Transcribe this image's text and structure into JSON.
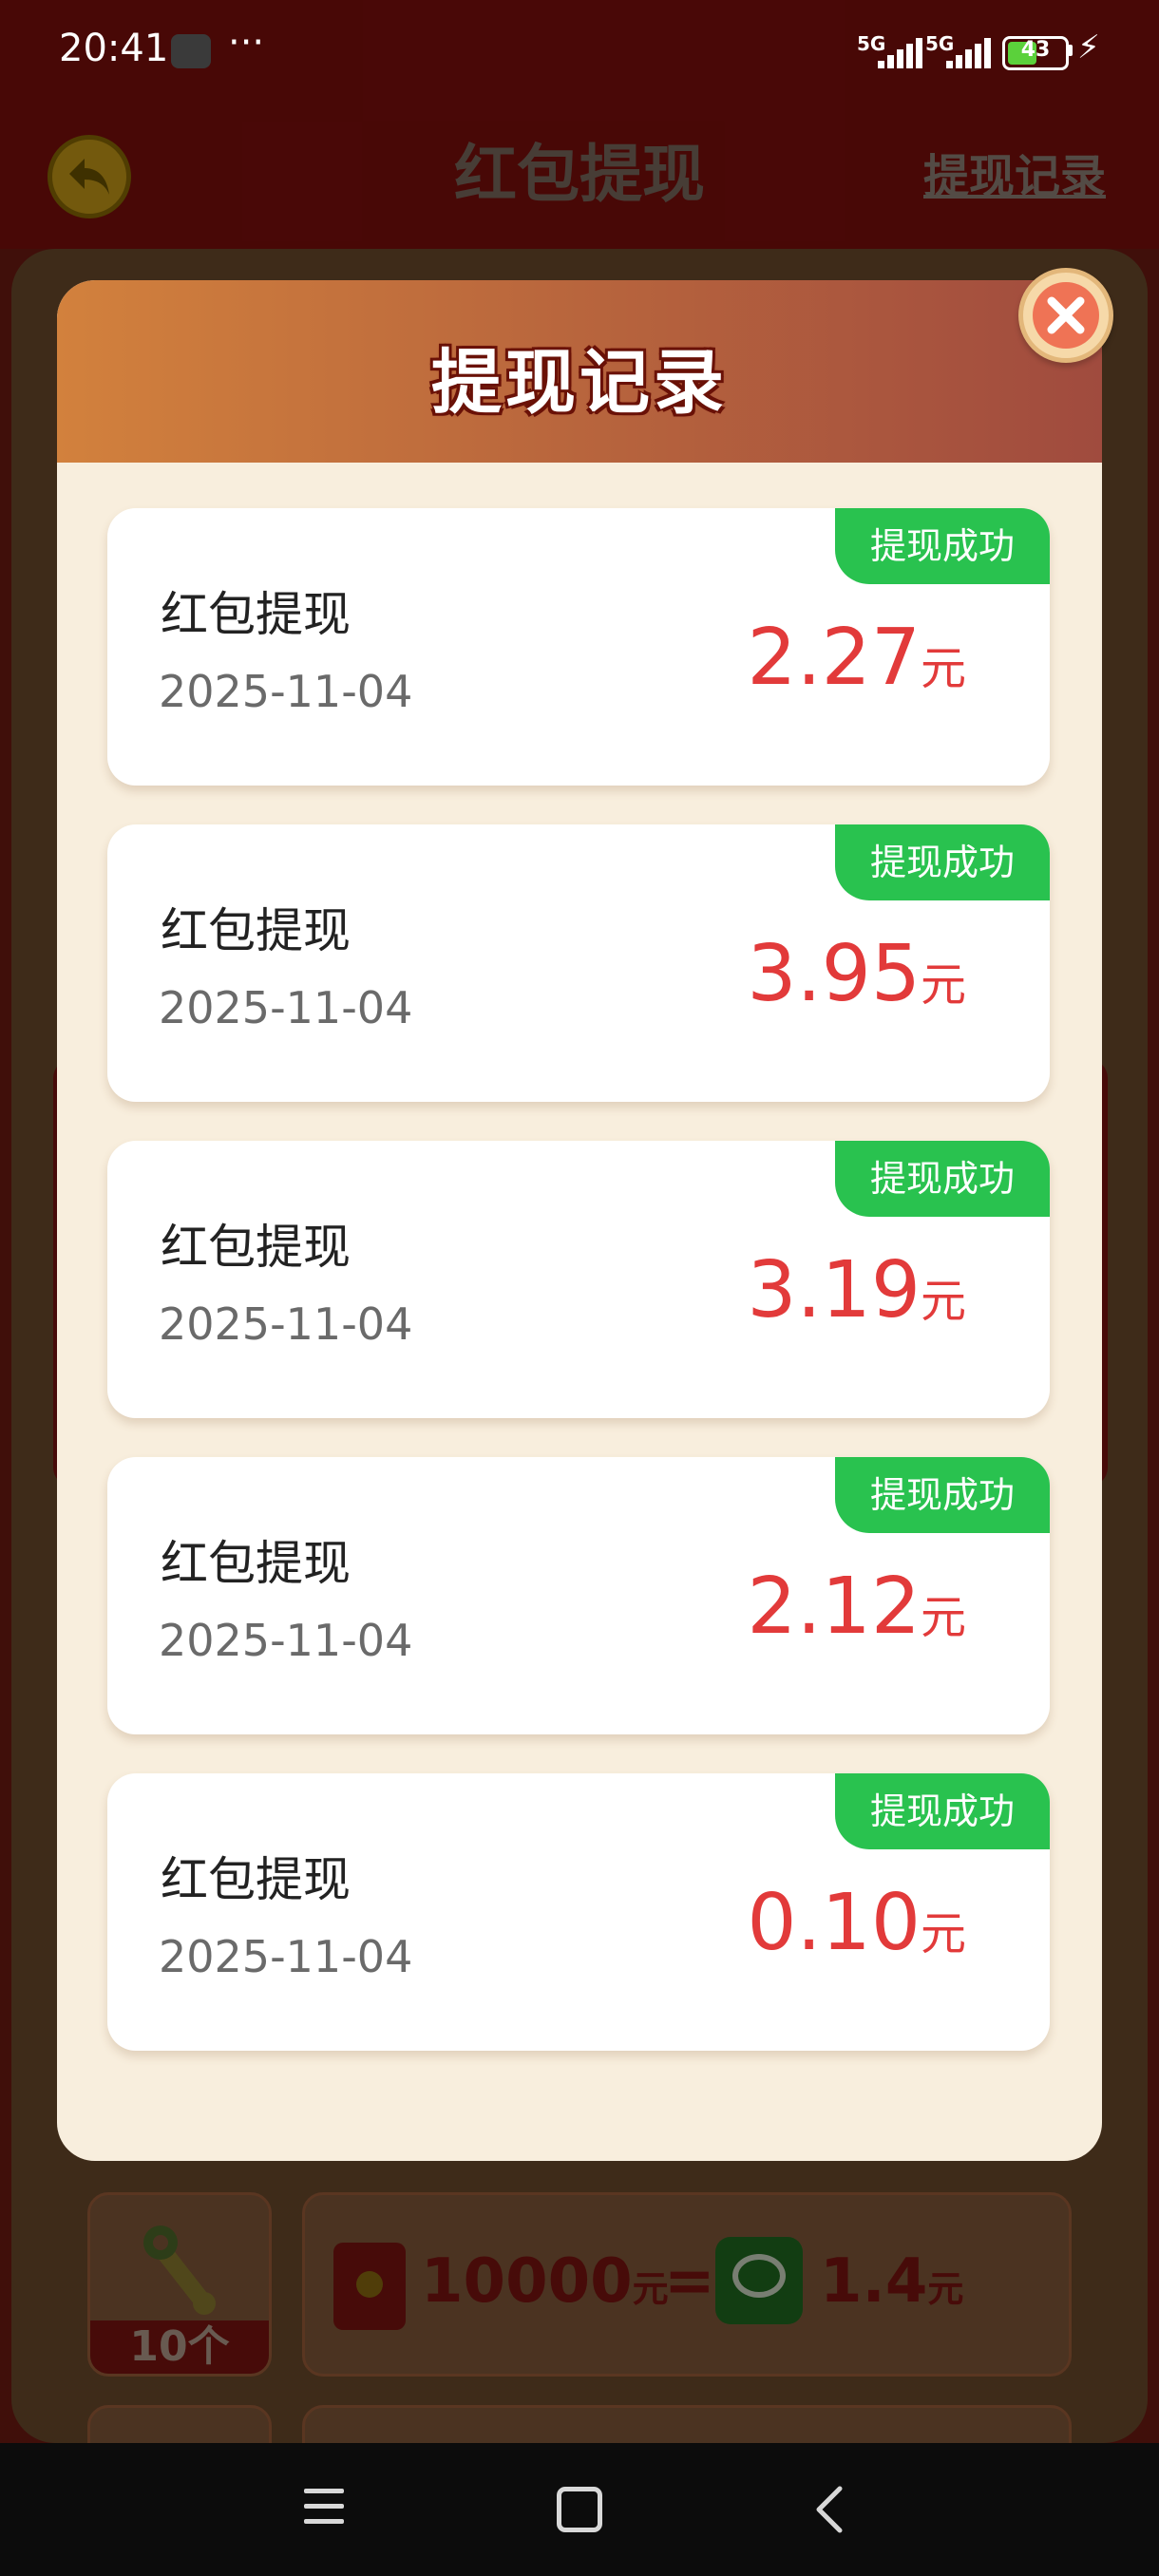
{
  "status_bar": {
    "time": "20:41",
    "more": "···",
    "sig1_label": "5G",
    "sig2_label": "5G",
    "battery": "43"
  },
  "header": {
    "title": "红包提现",
    "record_link": "提现记录"
  },
  "background": {
    "tool_count": "10个",
    "rate_amount": "10000",
    "rate_unit": "元",
    "equals": "=",
    "wechat_amount": "1.4",
    "wechat_unit": "元"
  },
  "modal": {
    "title": "提现记录",
    "records": [
      {
        "title": "红包提现",
        "date": "2025-11-04",
        "amount": "2.27",
        "unit": "元",
        "status": "提现成功"
      },
      {
        "title": "红包提现",
        "date": "2025-11-04",
        "amount": "3.95",
        "unit": "元",
        "status": "提现成功"
      },
      {
        "title": "红包提现",
        "date": "2025-11-04",
        "amount": "3.19",
        "unit": "元",
        "status": "提现成功"
      },
      {
        "title": "红包提现",
        "date": "2025-11-04",
        "amount": "2.12",
        "unit": "元",
        "status": "提现成功"
      },
      {
        "title": "红包提现",
        "date": "2025-11-04",
        "amount": "0.10",
        "unit": "元",
        "status": "提现成功"
      }
    ]
  },
  "colors": {
    "amount": "#e23a3a",
    "success_tag": "#29c24f",
    "modal_bg": "#f8eedd",
    "header_gradient_start": "#d2813d",
    "header_gradient_end": "#a04b3e"
  }
}
